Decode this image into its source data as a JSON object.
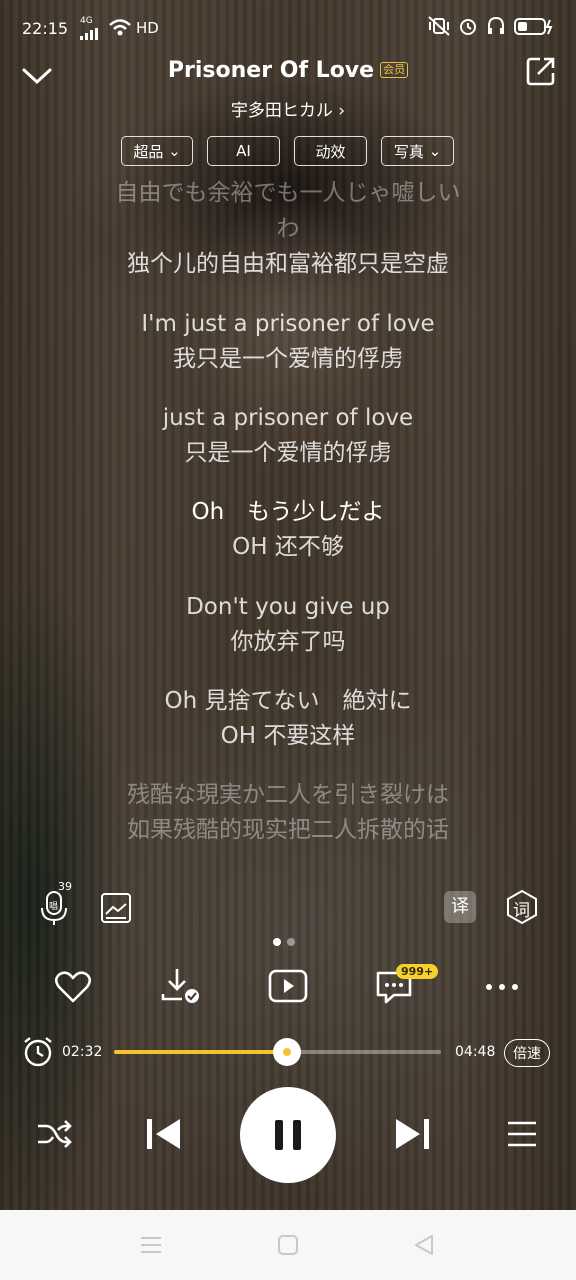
{
  "status_bar": {
    "time": "22:15",
    "signal": "4G",
    "network": "HD"
  },
  "song": {
    "title": "Prisoner Of Love",
    "vip_badge": "会员",
    "artist": "宇多田ヒカル"
  },
  "chips": [
    "超品",
    "AI",
    "动效",
    "写真"
  ],
  "lyrics": [
    {
      "text": "自由でも余裕でも一人じゃ嘘しい",
      "style": "dim"
    },
    {
      "text": "わ",
      "style": "dim"
    },
    {
      "text": "独个儿的自由和富裕都只是空虚",
      "style": "normal"
    },
    {
      "text": "I'm just a prisoner of love",
      "style": "normal"
    },
    {
      "text": "我只是一个爱情的俘虏",
      "style": "normal"
    },
    {
      "text": "just a prisoner of love",
      "style": "normal"
    },
    {
      "text": "只是一个爱情的俘虏",
      "style": "normal"
    },
    {
      "text": "Oh　もう少しだよ",
      "style": "current"
    },
    {
      "text": "OH 还不够",
      "style": "normal"
    },
    {
      "text": "Don't you give up",
      "style": "normal"
    },
    {
      "text": "你放弃了吗",
      "style": "normal"
    },
    {
      "text": "Oh 見捨てない　絶対に",
      "style": "normal"
    },
    {
      "text": "OH 不要这样",
      "style": "normal"
    },
    {
      "text": "残酷な現実か二人を引き裂けは",
      "style": "dim"
    },
    {
      "text": "如果残酷的现实把二人拆散的话",
      "style": "dim"
    }
  ],
  "tools": {
    "sing_count": "39",
    "translate": "译",
    "lyric": "词"
  },
  "comment_count": "999+",
  "player": {
    "elapsed": "02:32",
    "duration": "04:48",
    "progress_fraction": 0.528,
    "speed_label": "倍速",
    "page": {
      "current": 1,
      "total": 2
    }
  },
  "colors": {
    "accent": "#f3c431",
    "vip": "#e6c14a"
  }
}
